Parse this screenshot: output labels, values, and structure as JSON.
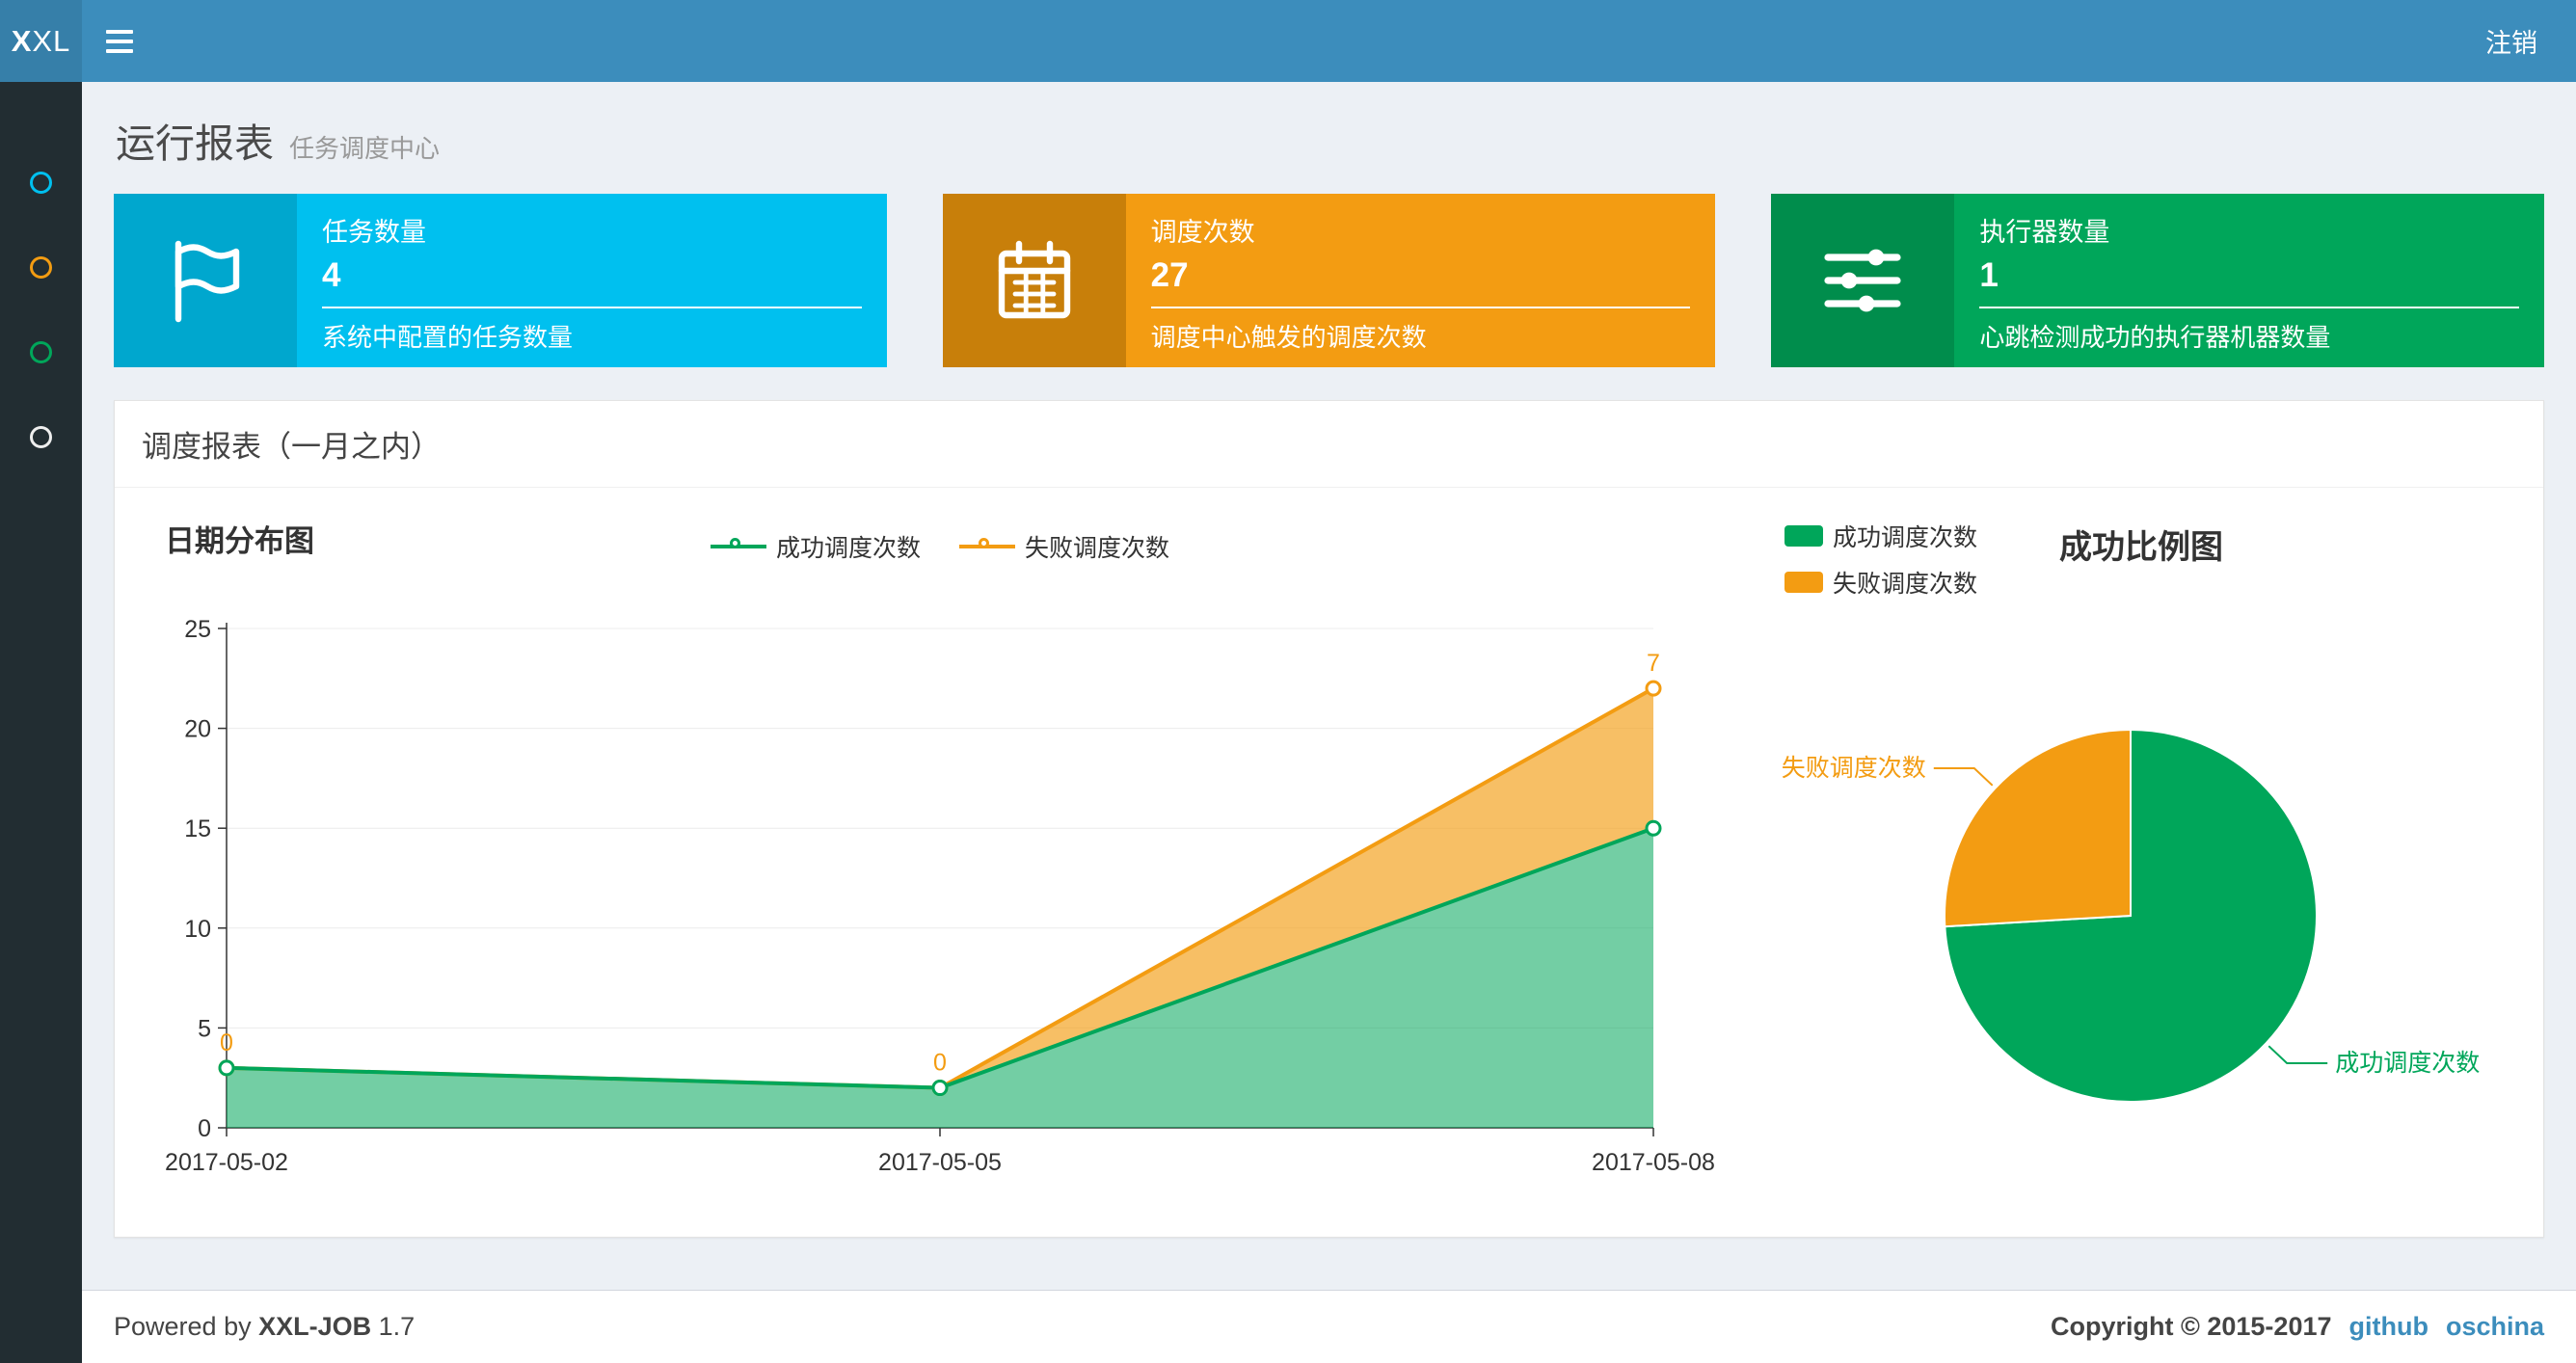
{
  "navbar": {
    "logo_bold": "X",
    "logo_rest": "XL",
    "logout": "注销"
  },
  "sidebar": {
    "items": [
      {
        "icon": "circle-icon",
        "color": "#00c0ef"
      },
      {
        "icon": "circle-icon",
        "color": "#f39c12"
      },
      {
        "icon": "circle-icon",
        "color": "#00a65a"
      },
      {
        "icon": "circle-icon",
        "color": "#eeeeee"
      }
    ]
  },
  "page": {
    "title": "运行报表",
    "subtitle": "任务调度中心"
  },
  "info_boxes": [
    {
      "icon": "flag-icon",
      "label": "任务数量",
      "value": "4",
      "desc": "系统中配置的任务数量",
      "bg": "#00c0ef",
      "icon_bg": "#00a7ce"
    },
    {
      "icon": "calendar-icon",
      "label": "调度次数",
      "value": "27",
      "desc": "调度中心触发的调度次数",
      "bg": "#f39c12",
      "icon_bg": "#c87f0a"
    },
    {
      "icon": "sliders-icon",
      "label": "执行器数量",
      "value": "1",
      "desc": "心跳检测成功的执行器机器数量",
      "bg": "#00a65a",
      "icon_bg": "#008d4c"
    }
  ],
  "panel": {
    "title": "调度报表（一月之内）"
  },
  "chart_data": [
    {
      "type": "area",
      "title": "日期分布图",
      "x": [
        "2017-05-02",
        "2017-05-05",
        "2017-05-08"
      ],
      "stacked": true,
      "ylim": [
        0,
        25
      ],
      "ytick": 5,
      "legend_position": "top",
      "series": [
        {
          "name": "成功调度次数",
          "values": [
            3,
            2,
            15
          ],
          "color": "#00a65a",
          "fill": "rgba(0,166,90,0.55)"
        },
        {
          "name": "失败调度次数",
          "values": [
            0,
            0,
            7
          ],
          "color": "#f39c12",
          "fill": "rgba(243,156,18,0.65)",
          "point_labels": [
            "0",
            "0",
            "7"
          ]
        }
      ]
    },
    {
      "type": "pie",
      "title": "成功比例图",
      "slices": [
        {
          "name": "成功调度次数",
          "value": 20,
          "color": "#00a65a"
        },
        {
          "name": "失败调度次数",
          "value": 7,
          "color": "#f39c12"
        }
      ]
    }
  ],
  "footer": {
    "powered_prefix": "Powered by",
    "brand": "XXL-JOB",
    "version": "1.7",
    "copyright": "Copyright © 2015-2017",
    "links": [
      {
        "label": "github"
      },
      {
        "label": "oschina"
      }
    ]
  }
}
